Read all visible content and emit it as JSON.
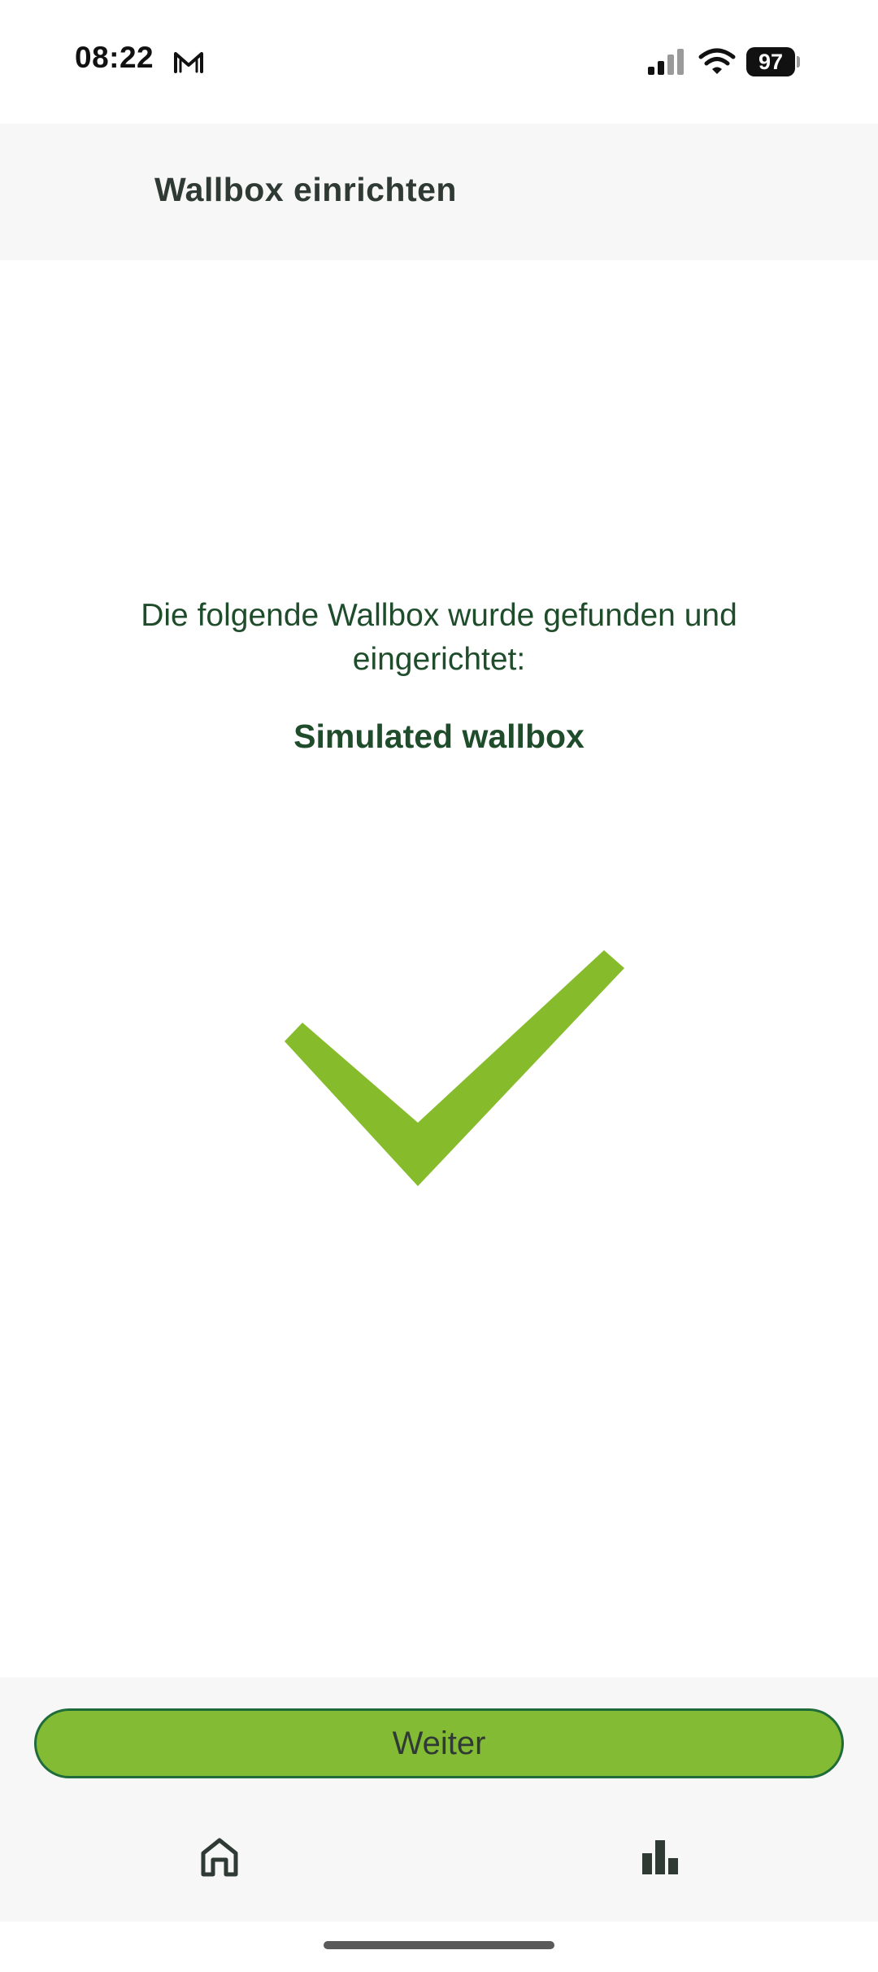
{
  "status_bar": {
    "time": "08:22",
    "battery_level": "97",
    "icons": [
      "mail-icon",
      "signal-icon",
      "wifi-icon",
      "battery-icon"
    ]
  },
  "header": {
    "title": "Wallbox einrichten"
  },
  "content": {
    "message": "Die folgende Wallbox wurde gefunden und eingerichtet:",
    "wallbox_name": "Simulated wallbox",
    "success_icon": "checkmark-icon"
  },
  "actions": {
    "continue_label": "Weiter"
  },
  "bottom_nav": {
    "items": [
      {
        "icon": "home-icon"
      },
      {
        "icon": "bar-chart-icon"
      }
    ]
  },
  "colors": {
    "accent_green": "#84bb34",
    "check_green": "#86bc2b",
    "text_dark_green": "#1f4d2b",
    "title_dark": "#2f3a34",
    "button_border": "#1f6b3a",
    "surface_gray": "#f7f7f7"
  }
}
